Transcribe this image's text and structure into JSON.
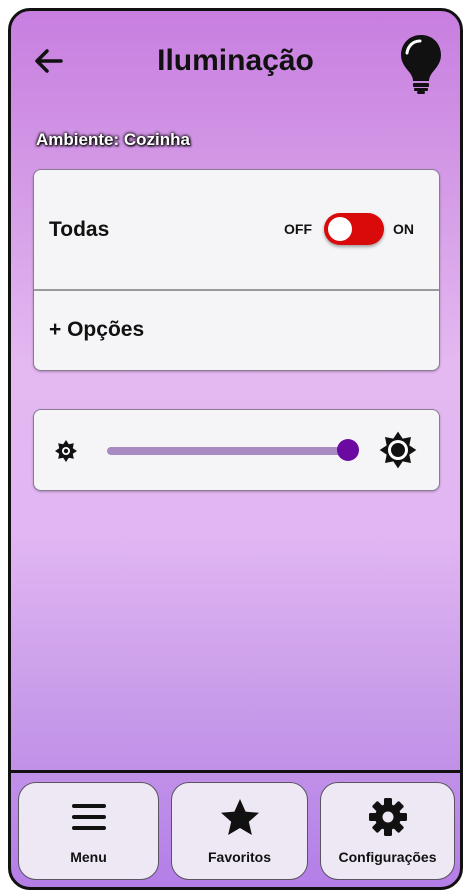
{
  "header": {
    "title": "Iluminação",
    "back_icon": "arrow-left-icon",
    "action_icon": "lightbulb-icon"
  },
  "ambiente_label": "Ambiente: Cozinha",
  "switch_card": {
    "label": "Todas",
    "off_label": "OFF",
    "on_label": "ON",
    "state": "on",
    "toggle_color": "#d80a0a",
    "options_label": "+ Opções"
  },
  "brightness": {
    "min_icon": "brightness-low-icon",
    "max_icon": "brightness-high-icon",
    "value_percent": 100,
    "thumb_color": "#6a0aa0"
  },
  "bottom_nav": {
    "items": [
      {
        "label": "Menu",
        "icon": "hamburger-menu-icon"
      },
      {
        "label": "Favoritos",
        "icon": "star-icon"
      },
      {
        "label": "Configurações",
        "icon": "gear-icon"
      }
    ]
  }
}
